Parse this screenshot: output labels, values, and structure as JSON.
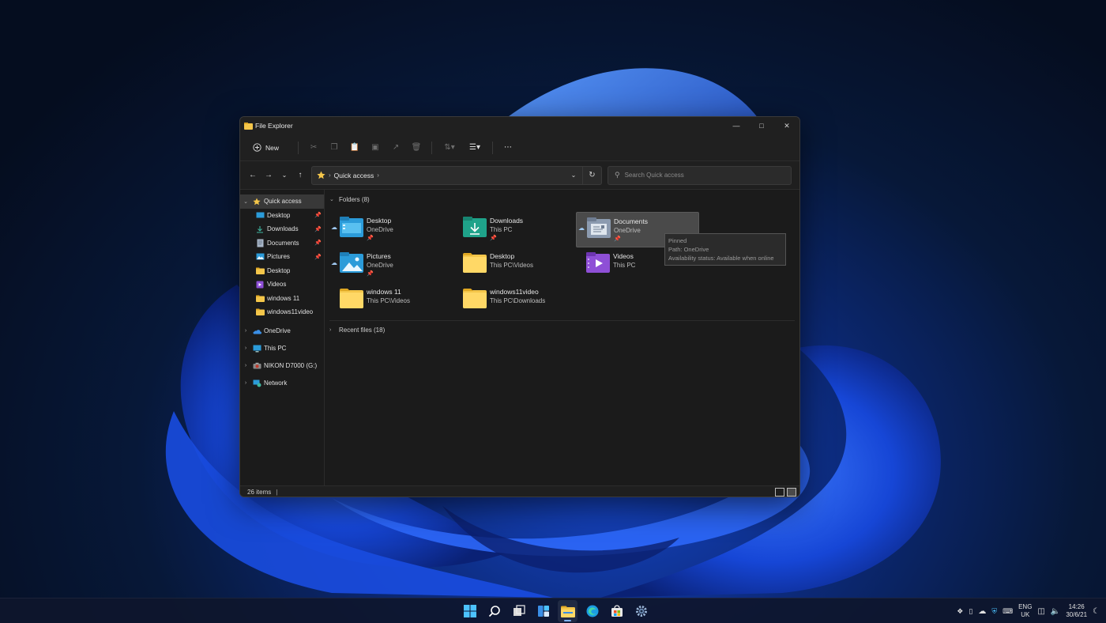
{
  "window": {
    "title": "File Explorer",
    "toolbar": {
      "new_label": "New",
      "more_label": "⋯"
    },
    "address": {
      "location": "Quick access",
      "search_placeholder": "Search Quick access"
    }
  },
  "sidebar": {
    "quick_access": "Quick access",
    "pinned": [
      {
        "label": "Desktop",
        "icon": "desktop-icon",
        "pinned": true
      },
      {
        "label": "Downloads",
        "icon": "download-icon",
        "pinned": true
      },
      {
        "label": "Documents",
        "icon": "document-icon",
        "pinned": true
      },
      {
        "label": "Pictures",
        "icon": "pictures-icon",
        "pinned": true
      },
      {
        "label": "Desktop",
        "icon": "folder-icon",
        "pinned": false
      },
      {
        "label": "Videos",
        "icon": "videos-icon",
        "pinned": false
      },
      {
        "label": "windows 11",
        "icon": "folder-icon",
        "pinned": false
      },
      {
        "label": "windows11video",
        "icon": "folder-icon",
        "pinned": false
      }
    ],
    "roots": [
      {
        "label": "OneDrive",
        "icon": "onedrive-icon"
      },
      {
        "label": "This PC",
        "icon": "this-pc-icon"
      },
      {
        "label": "NIKON D7000 (G:)",
        "icon": "camera-drive-icon"
      },
      {
        "label": "Network",
        "icon": "network-icon"
      }
    ]
  },
  "main": {
    "folders_header": "Folders (8)",
    "recent_header": "Recent files (18)",
    "folders": [
      {
        "name": "Desktop",
        "location": "OneDrive",
        "cloud": true,
        "pinned": true,
        "icon": "desktop-folder-icon"
      },
      {
        "name": "Downloads",
        "location": "This PC",
        "cloud": false,
        "pinned": true,
        "icon": "downloads-folder-icon"
      },
      {
        "name": "Documents",
        "location": "OneDrive",
        "cloud": true,
        "pinned": true,
        "icon": "documents-folder-icon"
      },
      {
        "name": "Pictures",
        "location": "OneDrive",
        "cloud": true,
        "pinned": true,
        "icon": "pictures-folder-icon"
      },
      {
        "name": "Desktop",
        "location": "This PC\\Videos",
        "cloud": false,
        "pinned": false,
        "icon": "folder-icon"
      },
      {
        "name": "Videos",
        "location": "This PC",
        "cloud": false,
        "pinned": false,
        "icon": "videos-folder-icon"
      },
      {
        "name": "windows 11",
        "location": "This PC\\Videos",
        "cloud": false,
        "pinned": false,
        "icon": "folder-icon"
      },
      {
        "name": "windows11video",
        "location": "This PC\\Downloads",
        "cloud": false,
        "pinned": false,
        "icon": "folder-icon"
      }
    ],
    "tooltip": {
      "line1": "Pinned",
      "line2": "Path: OneDrive",
      "line3": "Availability status: Available when online"
    }
  },
  "status": {
    "items": "26 items"
  },
  "taskbar": {
    "lang_top": "ENG",
    "lang_bottom": "UK",
    "time": "14:26",
    "date": "30/6/21"
  },
  "colors": {
    "folder_yellow": "#f4c64a",
    "accent_blue": "#3a8ee6",
    "desktop_blue": "#2b9bd9",
    "downloads_green": "#1fa38a"
  }
}
